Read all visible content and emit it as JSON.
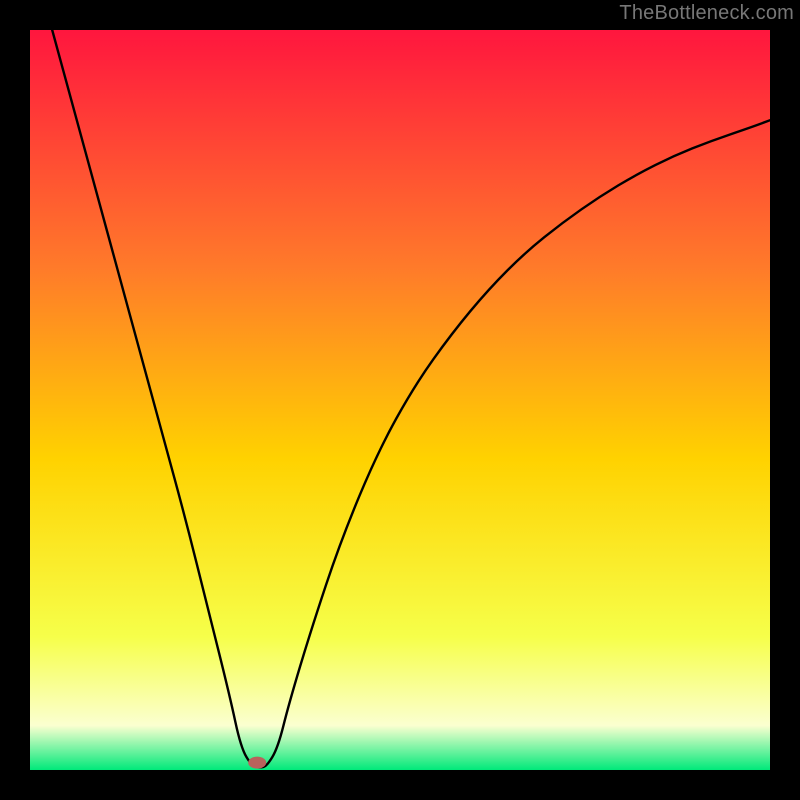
{
  "watermark": "TheBottleneck.com",
  "chart_data": {
    "type": "line",
    "title": "",
    "xlabel": "",
    "ylabel": "",
    "xlim": [
      0,
      1
    ],
    "ylim": [
      0,
      1
    ],
    "gradient_colors": {
      "top": "#ff163e",
      "upper_mid": "#ff7a2a",
      "mid": "#ffd200",
      "lower_mid": "#f6ff4a",
      "pale": "#fbffd0",
      "bottom": "#00e97a"
    },
    "series": [
      {
        "name": "bottleneck-curve",
        "stroke": "#000000",
        "x": [
          0.03,
          0.06,
          0.09,
          0.12,
          0.15,
          0.18,
          0.21,
          0.24,
          0.27,
          0.285,
          0.3,
          0.31,
          0.32,
          0.335,
          0.35,
          0.38,
          0.42,
          0.47,
          0.52,
          0.57,
          0.62,
          0.67,
          0.72,
          0.77,
          0.82,
          0.87,
          0.92,
          0.97,
          1.0
        ],
        "y": [
          1.0,
          0.89,
          0.78,
          0.67,
          0.56,
          0.45,
          0.34,
          0.22,
          0.1,
          0.03,
          0.005,
          0.003,
          0.005,
          0.03,
          0.09,
          0.19,
          0.31,
          0.43,
          0.52,
          0.59,
          0.65,
          0.7,
          0.74,
          0.775,
          0.805,
          0.83,
          0.85,
          0.867,
          0.878
        ]
      }
    ],
    "marker": {
      "name": "bottleneck-point",
      "x": 0.307,
      "y": 0.01,
      "fill": "#b9625c",
      "rx": 9,
      "ry": 6
    }
  }
}
